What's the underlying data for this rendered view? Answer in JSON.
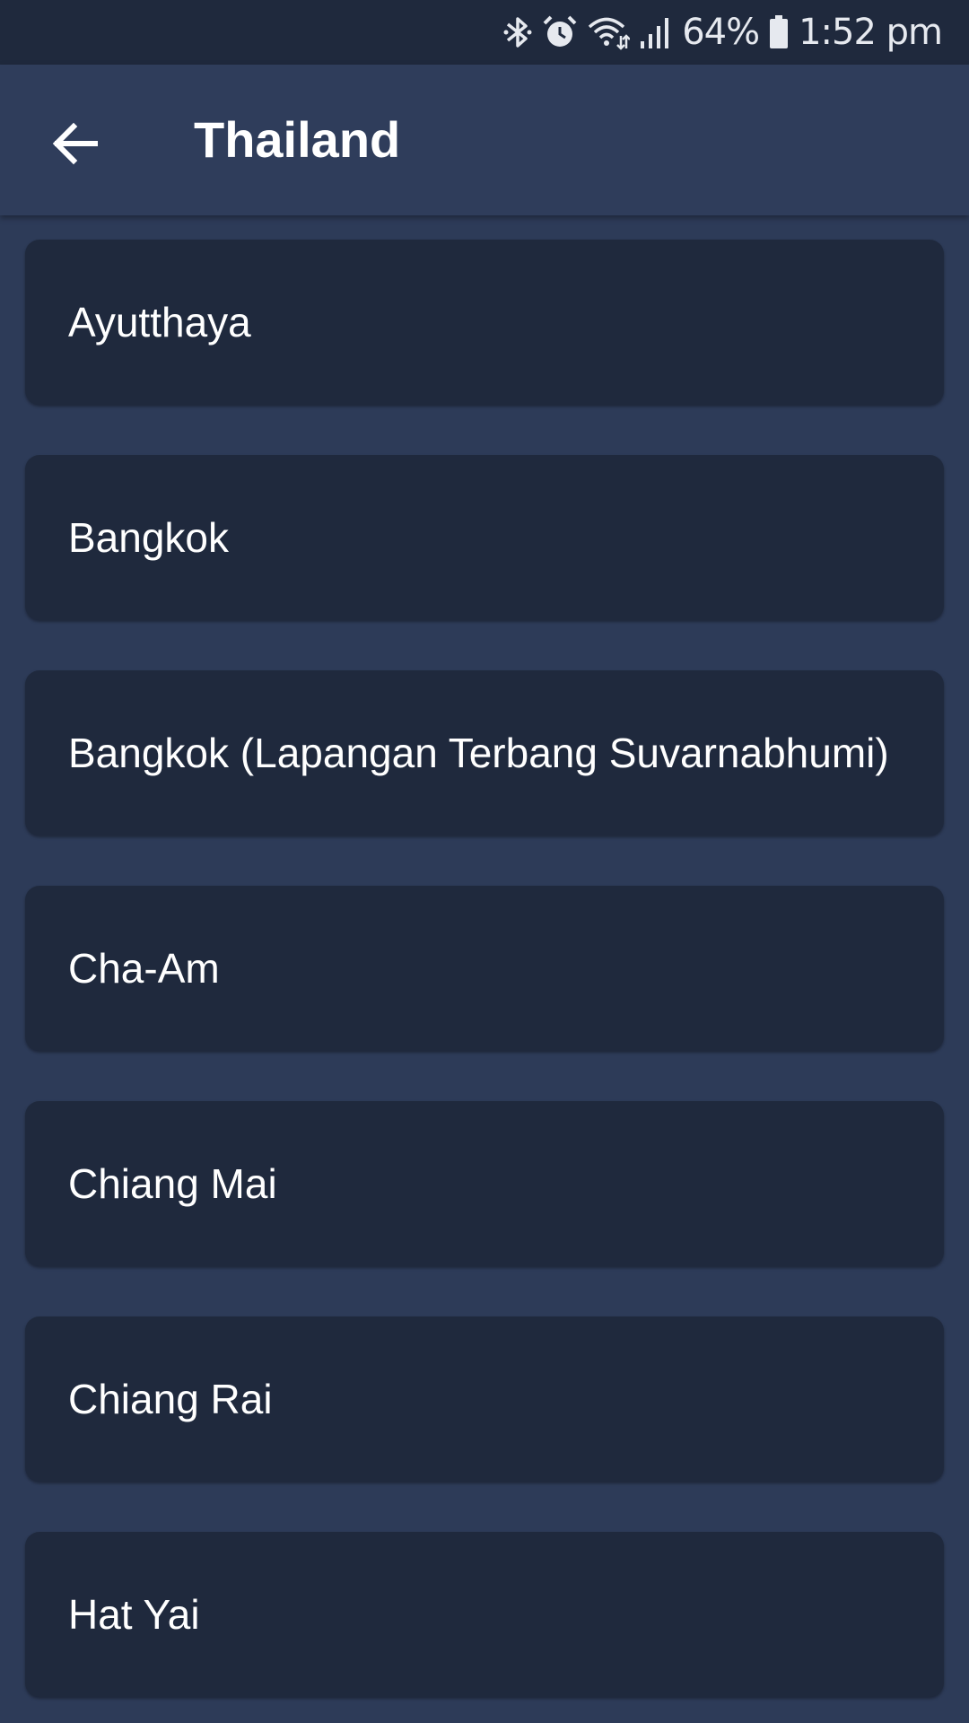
{
  "status_bar": {
    "battery": "64%",
    "time": "1:52 pm",
    "icons": [
      "bluetooth-icon",
      "alarm-icon",
      "wifi-icon",
      "signal-icon",
      "battery-icon"
    ]
  },
  "app_bar": {
    "back_icon": "arrow-left-icon",
    "title": "Thailand"
  },
  "cities": [
    {
      "label": "Ayutthaya"
    },
    {
      "label": "Bangkok"
    },
    {
      "label": "Bangkok (Lapangan Terbang Suvarnabhumi)"
    },
    {
      "label": "Cha-Am"
    },
    {
      "label": "Chiang Mai"
    },
    {
      "label": "Chiang Rai"
    },
    {
      "label": "Hat Yai"
    }
  ],
  "colors": {
    "background": "#2d3b58",
    "app_bar": "#2f3d5b",
    "status_bar": "#1f293d",
    "card": "#1f293d",
    "text": "#ffffff"
  }
}
